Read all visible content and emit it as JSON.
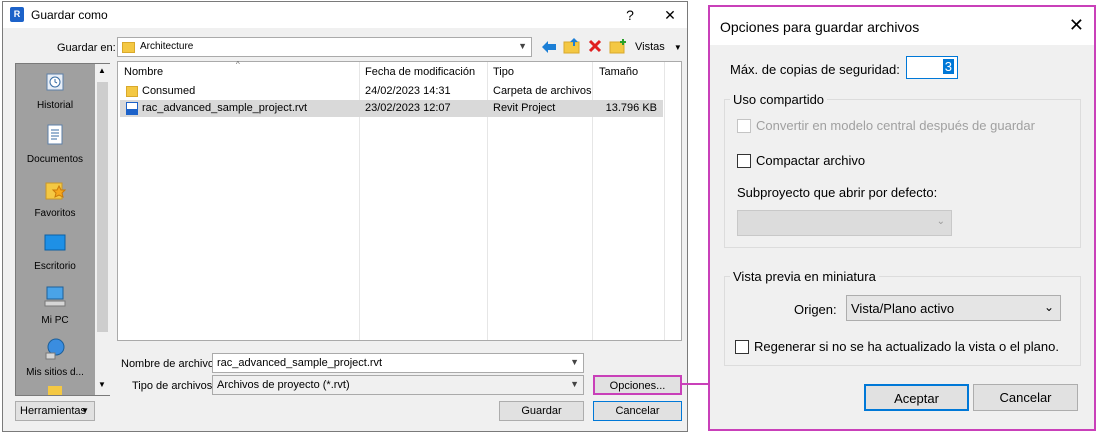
{
  "save_dialog": {
    "title": "Guardar como",
    "help_glyph": "?",
    "close_glyph": "✕",
    "save_in_label": "Guardar en:",
    "save_in_value": "Architecture",
    "views_label": "Vistas",
    "places": [
      {
        "label": "Historial",
        "icon": "history-icon"
      },
      {
        "label": "Documentos",
        "icon": "documents-icon"
      },
      {
        "label": "Favoritos",
        "icon": "favorites-icon"
      },
      {
        "label": "Escritorio",
        "icon": "desktop-icon"
      },
      {
        "label": "Mi PC",
        "icon": "computer-icon"
      },
      {
        "label": "Mis sitios d...",
        "icon": "network-icon"
      }
    ],
    "columns": {
      "name": "Nombre",
      "modified": "Fecha de modificación",
      "type": "Tipo",
      "size": "Tamaño"
    },
    "files": [
      {
        "name": "Consumed",
        "modified": "24/02/2023 14:31",
        "type": "Carpeta de archivos",
        "size": ""
      },
      {
        "name": "rac_advanced_sample_project.rvt",
        "modified": "23/02/2023 12:07",
        "type": "Revit Project",
        "size": "13.796 KB"
      }
    ],
    "filename_label": "Nombre de archivo:",
    "filename_value": "rac_advanced_sample_project.rvt",
    "filetype_label": "Tipo de archivos:",
    "filetype_value": "Archivos de proyecto  (*.rvt)",
    "options_button": "Opciones...",
    "save_button": "Guardar",
    "cancel_button": "Cancelar",
    "tools_button": "Herramientas"
  },
  "options_dialog": {
    "title": "Opciones para guardar archivos",
    "close_glyph": "✕",
    "max_backups_label": "Máx. de copias de seguridad:",
    "max_backups_value": "3",
    "sharing_group": "Uso compartido",
    "make_central_label": "Convertir en modelo central después de guardar",
    "compact_label": "Compactar archivo",
    "workset_label": "Subproyecto que abrir por defecto:",
    "thumbnail_group": "Vista previa en miniatura",
    "source_label": "Origen:",
    "source_value": "Vista/Plano activo",
    "regenerate_label": "Regenerar si no se ha actualizado la vista o el plano.",
    "ok_button": "Aceptar",
    "cancel_button": "Cancelar"
  },
  "colors": {
    "highlight": "#c940b9",
    "selection": "#d9d9d9",
    "accent": "#0078d7"
  }
}
